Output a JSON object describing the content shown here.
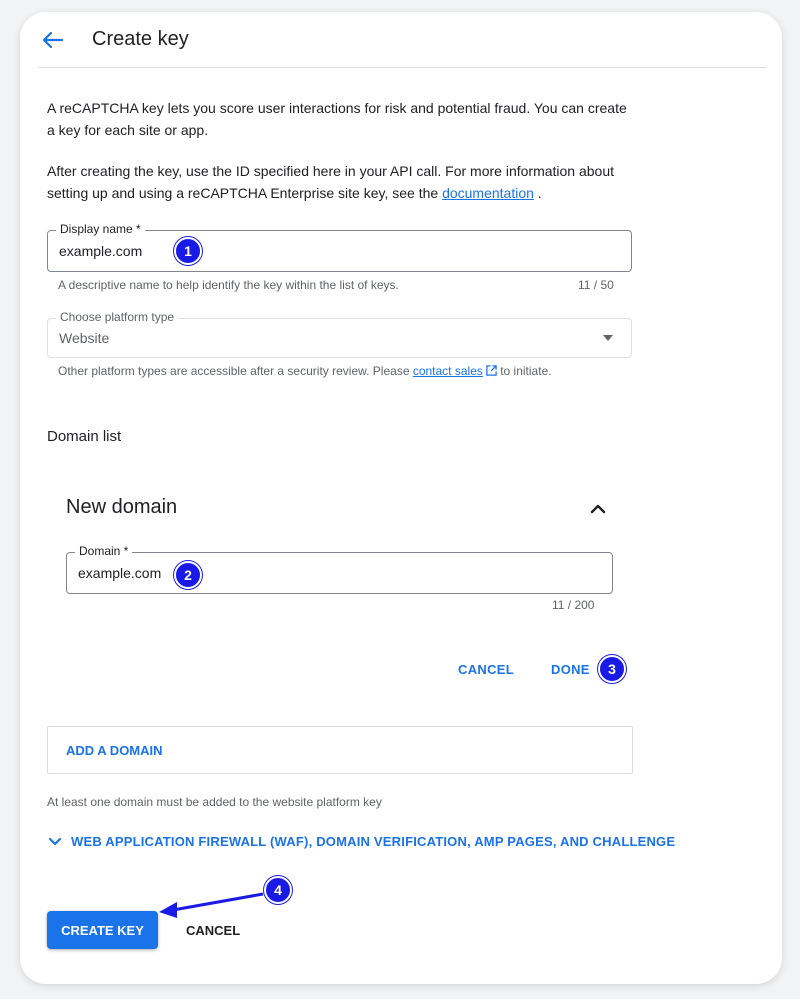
{
  "header": {
    "title": "Create key"
  },
  "intro": {
    "p1": "A reCAPTCHA key lets you score user interactions for risk and potential fraud. You can create a key for each site or app.",
    "p2_before": "After creating the key, use the ID specified here in your API call. For more information about setting up and using a reCAPTCHA Enterprise site key, see the ",
    "p2_link": "documentation",
    "p2_after": " ."
  },
  "display_name": {
    "label": "Display name *",
    "value": "example.com",
    "helper": "A descriptive name to help identify the key within the list of keys.",
    "counter": "11 / 50"
  },
  "platform": {
    "label": "Choose platform type",
    "value": "Website",
    "helper_before": "Other platform types are accessible after a security review. Please ",
    "helper_link": "contact sales",
    "helper_after": " to initiate."
  },
  "domain_list": {
    "label": "Domain list",
    "panel_title": "New domain",
    "field_label": "Domain *",
    "field_value": "example.com",
    "counter": "11 / 200",
    "cancel_label": "CANCEL",
    "done_label": "DONE",
    "add_label": "ADD A DOMAIN",
    "note": "At least one domain must be added to the website platform key"
  },
  "waf": {
    "label": "WEB APPLICATION FIREWALL (WAF), DOMAIN VERIFICATION, AMP PAGES, AND CHALLENGE"
  },
  "footer": {
    "create_label": "CREATE KEY",
    "cancel_label": "CANCEL"
  },
  "annotations": {
    "b1": "1",
    "b2": "2",
    "b3": "3",
    "b4": "4"
  },
  "colors": {
    "accent": "#1a73e8",
    "badge": "#1a1ae6"
  }
}
